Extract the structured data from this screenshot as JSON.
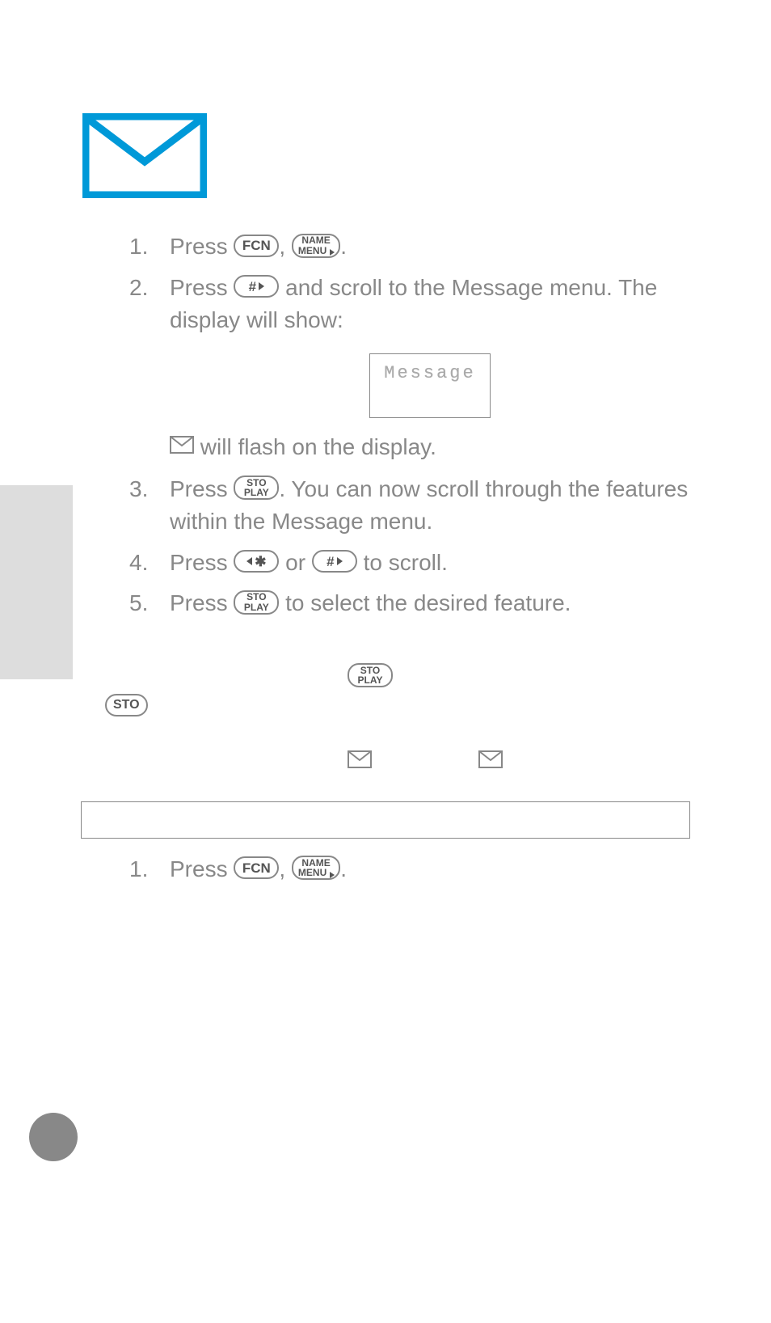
{
  "steps_upper": [
    {
      "num": "1.",
      "parts": [
        {
          "t": "Press "
        },
        {
          "key": "fcn"
        },
        {
          "t": ", "
        },
        {
          "key": "namemenu"
        },
        {
          "t": "."
        }
      ]
    },
    {
      "num": "2.",
      "parts": [
        {
          "t": "Press "
        },
        {
          "key": "hash-right"
        },
        {
          "t": " and scroll to the Message menu. The display will show:"
        }
      ],
      "after_display": true,
      "after_text_parts": [
        {
          "icon": "env"
        },
        {
          "t": " will flash on the display."
        }
      ]
    },
    {
      "num": "3.",
      "parts": [
        {
          "t": "Press "
        },
        {
          "key": "stoplay"
        },
        {
          "t": ". You can now scroll through the features within the Message menu."
        }
      ]
    },
    {
      "num": "4.",
      "parts": [
        {
          "t": "Press "
        },
        {
          "key": "left-star"
        },
        {
          "t": " or "
        },
        {
          "key": "hash-right"
        },
        {
          "t": " to scroll."
        }
      ]
    },
    {
      "num": "5.",
      "parts": [
        {
          "t": "Press "
        },
        {
          "key": "stoplay"
        },
        {
          "t": " to select the desired feature."
        }
      ]
    }
  ],
  "display_text": "Message",
  "note": {},
  "feature_box_label": "",
  "steps_lower": [
    {
      "num": "1.",
      "parts": [
        {
          "t": "Press "
        },
        {
          "key": "fcn"
        },
        {
          "t": ", "
        },
        {
          "key": "namemenu"
        },
        {
          "t": "."
        }
      ]
    }
  ],
  "keys": {
    "fcn": "FCN",
    "namemenu_top": "NAME",
    "namemenu_bot": "MENU",
    "hash": "#",
    "star": "✱",
    "sto": "STO",
    "play": "PLAY"
  }
}
